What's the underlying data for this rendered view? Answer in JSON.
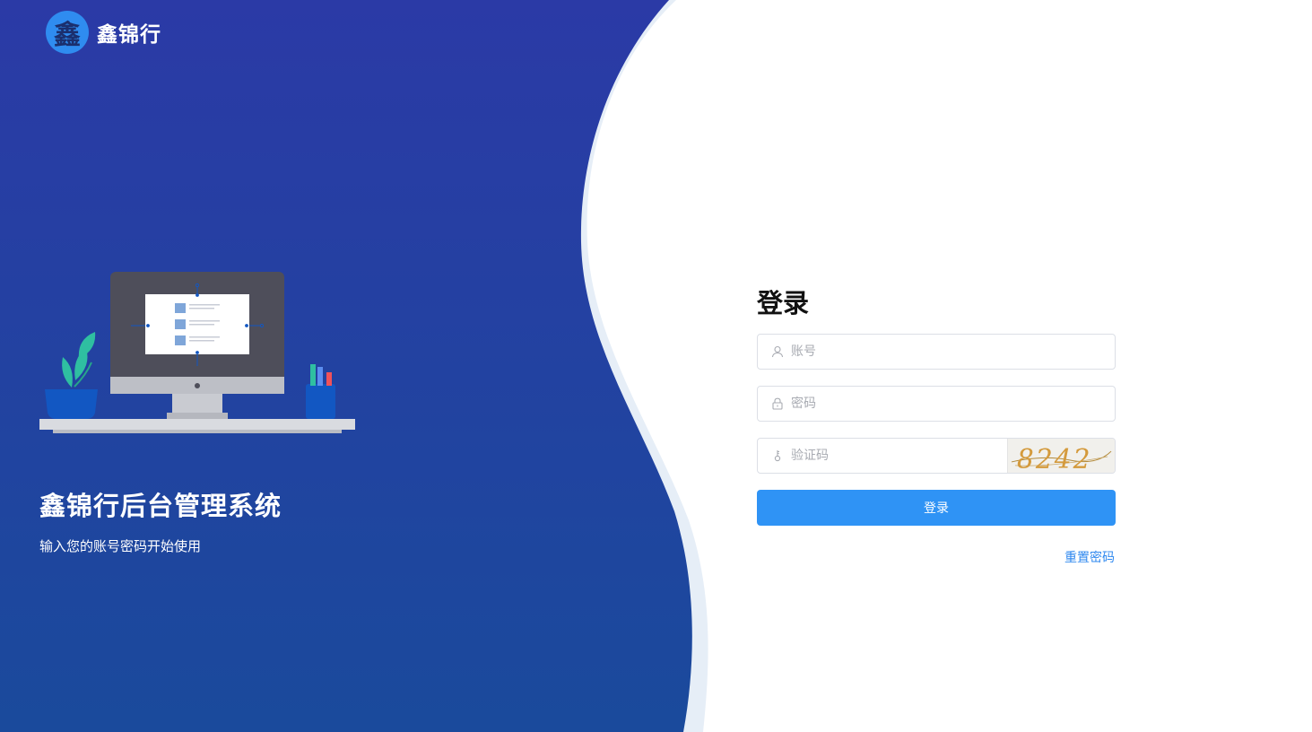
{
  "brand": {
    "logo_char": "鑫",
    "name": "鑫锦行"
  },
  "hero": {
    "title": "鑫锦行后台管理系统",
    "subtitle": "输入您的账号密码开始使用"
  },
  "login": {
    "title": "登录",
    "username_placeholder": "账号",
    "password_placeholder": "密码",
    "captcha_placeholder": "验证码",
    "captcha_text": "8242",
    "submit_label": "登录",
    "reset_label": "重置密码"
  },
  "colors": {
    "panel_gradient_top": "#2b3aa6",
    "panel_gradient_bottom": "#1a4a9c",
    "primary": "#2f93f5",
    "link": "#2f88ef"
  },
  "icons": {
    "username": "user-icon",
    "password": "lock-icon",
    "captcha": "key-icon"
  }
}
